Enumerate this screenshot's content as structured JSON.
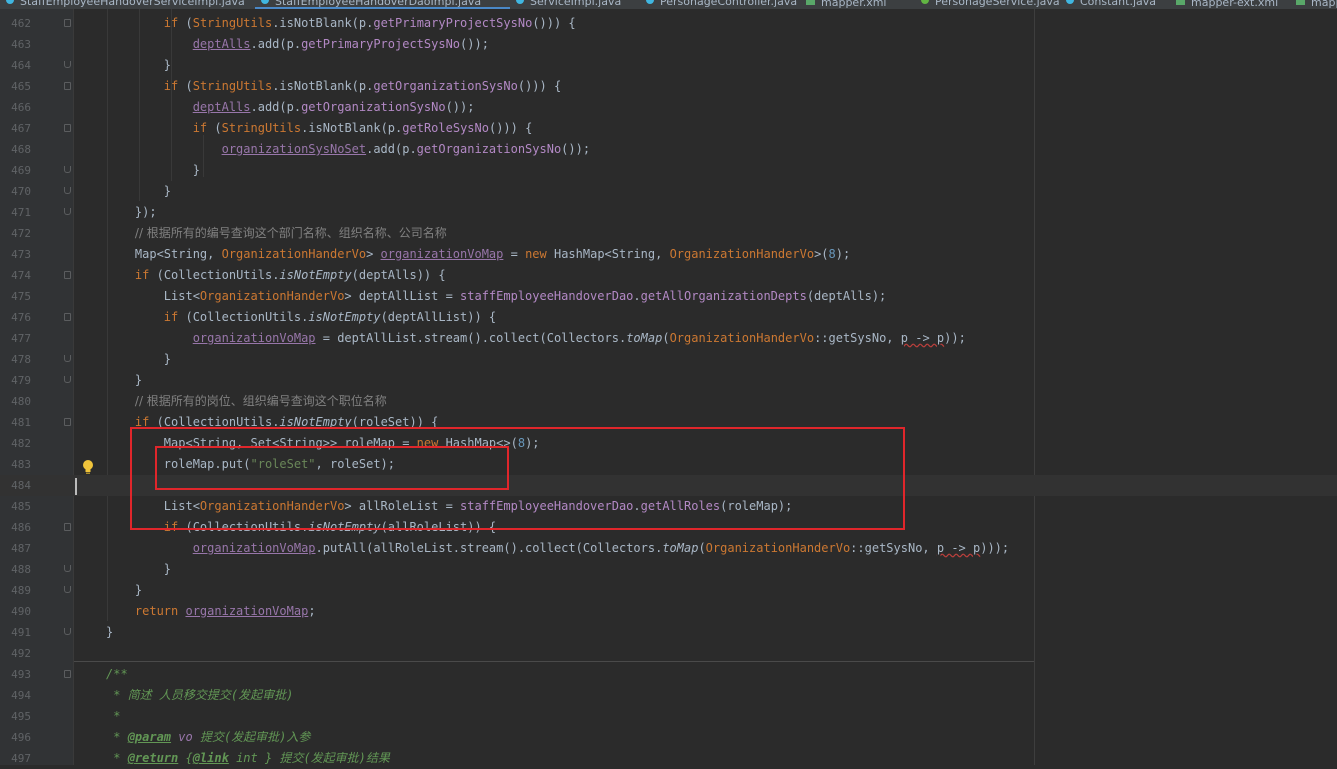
{
  "editor_tabs": [
    {
      "label": "StaffEmployeeHandoverServiceImpl.java",
      "kind": "java",
      "active": false
    },
    {
      "label": "StaffEmployeeHandoverDaoImpl.java",
      "kind": "java",
      "active": true
    },
    {
      "label": "ServiceImpl.java",
      "kind": "java",
      "active": false
    },
    {
      "label": "PersonageController.java",
      "kind": "java",
      "active": false
    },
    {
      "label": "mapper.xml",
      "kind": "xml",
      "active": false
    },
    {
      "label": "PersonageService.java",
      "kind": "service",
      "active": false
    },
    {
      "label": "Constant.java",
      "kind": "java",
      "active": false
    },
    {
      "label": "mapper-ext.xml",
      "kind": "xml",
      "active": false
    },
    {
      "label": "mapper.xml",
      "kind": "xml",
      "active": false
    }
  ],
  "lines": [
    {
      "num": "462",
      "tokens": [
        [
          "plain",
          "        "
        ],
        [
          "kw",
          "if "
        ],
        [
          "plain",
          "("
        ],
        [
          "ty",
          "StringUtils"
        ],
        [
          "plain",
          ".isNotBlank(p."
        ],
        [
          "mtd",
          "getPrimaryProjectSysNo"
        ],
        [
          "plain",
          "())) {"
        ]
      ]
    },
    {
      "num": "463",
      "tokens": [
        [
          "plain",
          "            "
        ],
        [
          "fld ul",
          "deptAlls"
        ],
        [
          "plain",
          ".add(p."
        ],
        [
          "mtd",
          "getPrimaryProjectSysNo"
        ],
        [
          "plain",
          "());"
        ]
      ]
    },
    {
      "num": "464",
      "tokens": [
        [
          "plain",
          "        }"
        ]
      ]
    },
    {
      "num": "465",
      "tokens": [
        [
          "plain",
          "        "
        ],
        [
          "kw",
          "if "
        ],
        [
          "plain",
          "("
        ],
        [
          "ty",
          "StringUtils"
        ],
        [
          "plain",
          ".isNotBlank(p."
        ],
        [
          "mtd",
          "getOrganizationSysNo"
        ],
        [
          "plain",
          "())) {"
        ]
      ]
    },
    {
      "num": "466",
      "tokens": [
        [
          "plain",
          "            "
        ],
        [
          "fld ul",
          "deptAlls"
        ],
        [
          "plain",
          ".add(p."
        ],
        [
          "mtd",
          "getOrganizationSysNo"
        ],
        [
          "plain",
          "());"
        ]
      ]
    },
    {
      "num": "467",
      "tokens": [
        [
          "plain",
          "            "
        ],
        [
          "kw",
          "if "
        ],
        [
          "plain",
          "("
        ],
        [
          "ty",
          "StringUtils"
        ],
        [
          "plain",
          ".isNotBlank(p."
        ],
        [
          "mtd",
          "getRoleSysNo"
        ],
        [
          "plain",
          "())) {"
        ]
      ]
    },
    {
      "num": "468",
      "tokens": [
        [
          "plain",
          "                "
        ],
        [
          "fld ul",
          "organizationSysNoSet"
        ],
        [
          "plain",
          ".add(p."
        ],
        [
          "mtd",
          "getOrganizationSysNo"
        ],
        [
          "plain",
          "());"
        ]
      ]
    },
    {
      "num": "469",
      "tokens": [
        [
          "plain",
          "            }"
        ]
      ]
    },
    {
      "num": "470",
      "tokens": [
        [
          "plain",
          "        }"
        ]
      ]
    },
    {
      "num": "471",
      "tokens": [
        [
          "plain",
          "    });"
        ]
      ]
    },
    {
      "num": "472",
      "tokens": [
        [
          "plain",
          "    "
        ],
        [
          "cm",
          "// 根据所有的编号查询这个部门名称、组织名称、公司名称"
        ]
      ]
    },
    {
      "num": "473",
      "tokens": [
        [
          "plain",
          "    Map<String, "
        ],
        [
          "ty",
          "OrganizationHanderVo"
        ],
        [
          "plain",
          "> "
        ],
        [
          "fld ul",
          "organizationVoMap"
        ],
        [
          "plain",
          " = "
        ],
        [
          "kw",
          "new "
        ],
        [
          "plain",
          "HashMap<String, "
        ],
        [
          "ty",
          "OrganizationHanderVo"
        ],
        [
          "plain",
          ">("
        ],
        [
          "num",
          "8"
        ],
        [
          "plain",
          ");"
        ]
      ]
    },
    {
      "num": "474",
      "tokens": [
        [
          "plain",
          "    "
        ],
        [
          "kw",
          "if "
        ],
        [
          "plain",
          "(CollectionUtils."
        ],
        [
          "it",
          "isNotEmpty"
        ],
        [
          "plain",
          "(deptAlls)) {"
        ]
      ]
    },
    {
      "num": "475",
      "tokens": [
        [
          "plain",
          "        List<"
        ],
        [
          "ty",
          "OrganizationHanderVo"
        ],
        [
          "plain",
          "> deptAllList = "
        ],
        [
          "mtd",
          "staffEmployeeHandoverDao"
        ],
        [
          "plain",
          "."
        ],
        [
          "mtd",
          "getAllOrganizationDepts"
        ],
        [
          "plain",
          "(deptAlls);"
        ]
      ]
    },
    {
      "num": "476",
      "tokens": [
        [
          "plain",
          "        "
        ],
        [
          "kw",
          "if "
        ],
        [
          "plain",
          "(CollectionUtils."
        ],
        [
          "it",
          "isNotEmpty"
        ],
        [
          "plain",
          "(deptAllList)) {"
        ]
      ]
    },
    {
      "num": "477",
      "tokens": [
        [
          "plain",
          "            "
        ],
        [
          "fld ul",
          "organizationVoMap"
        ],
        [
          "plain",
          " = deptAllList.stream().collect(Collectors."
        ],
        [
          "it",
          "toMap"
        ],
        [
          "plain",
          "("
        ],
        [
          "ty",
          "OrganizationHanderVo"
        ],
        [
          "plain",
          "::getSysNo, "
        ],
        [
          "wavy",
          "p -> p"
        ],
        [
          "plain",
          "));"
        ]
      ]
    },
    {
      "num": "478",
      "tokens": [
        [
          "plain",
          "        }"
        ]
      ]
    },
    {
      "num": "479",
      "tokens": [
        [
          "plain",
          "    }"
        ]
      ]
    },
    {
      "num": "480",
      "tokens": [
        [
          "plain",
          "    "
        ],
        [
          "cm",
          "// 根据所有的岗位、组织编号查询这个职位名称"
        ]
      ]
    },
    {
      "num": "481",
      "tokens": [
        [
          "plain",
          "    "
        ],
        [
          "kw",
          "if "
        ],
        [
          "plain",
          "(CollectionUtils."
        ],
        [
          "it",
          "isNotEmpty"
        ],
        [
          "plain",
          "(roleSet)) {"
        ]
      ]
    },
    {
      "num": "482",
      "tokens": [
        [
          "plain",
          "        Map<String, Set<String>> roleMap = "
        ],
        [
          "kw",
          "new "
        ],
        [
          "plain",
          "HashMap<>("
        ],
        [
          "num",
          "8"
        ],
        [
          "plain",
          ");"
        ]
      ]
    },
    {
      "num": "483",
      "tokens": [
        [
          "plain",
          "        roleMap.put("
        ],
        [
          "str",
          "\"roleSet\""
        ],
        [
          "plain",
          ", roleSet);"
        ]
      ]
    },
    {
      "num": "484",
      "tokens": []
    },
    {
      "num": "485",
      "tokens": [
        [
          "plain",
          "        List<"
        ],
        [
          "ty",
          "OrganizationHanderVo"
        ],
        [
          "plain",
          "> allRoleList = "
        ],
        [
          "mtd",
          "staffEmployeeHandoverDao"
        ],
        [
          "plain",
          "."
        ],
        [
          "mtd",
          "getAllRoles"
        ],
        [
          "plain",
          "(roleMap);"
        ]
      ]
    },
    {
      "num": "486",
      "tokens": [
        [
          "plain",
          "        "
        ],
        [
          "kw",
          "if "
        ],
        [
          "plain",
          "(CollectionUtils."
        ],
        [
          "it",
          "isNotEmpty"
        ],
        [
          "plain",
          "(allRoleList)) {"
        ]
      ]
    },
    {
      "num": "487",
      "tokens": [
        [
          "plain",
          "            "
        ],
        [
          "fld ul",
          "organizationVoMap"
        ],
        [
          "plain",
          ".putAll(allRoleList.stream().collect(Collectors."
        ],
        [
          "it",
          "toMap"
        ],
        [
          "plain",
          "("
        ],
        [
          "ty",
          "OrganizationHanderVo"
        ],
        [
          "plain",
          "::getSysNo, "
        ],
        [
          "wavy",
          "p -> p"
        ],
        [
          "plain",
          ")));"
        ]
      ]
    },
    {
      "num": "488",
      "tokens": [
        [
          "plain",
          "        }"
        ]
      ]
    },
    {
      "num": "489",
      "tokens": [
        [
          "plain",
          "    }"
        ]
      ]
    },
    {
      "num": "490",
      "tokens": [
        [
          "plain",
          "    "
        ],
        [
          "kw",
          "return "
        ],
        [
          "fld ul",
          "organizationVoMap"
        ],
        [
          "plain",
          ";"
        ]
      ]
    },
    {
      "num": "491",
      "tokens": [
        [
          "plain",
          "}"
        ]
      ]
    },
    {
      "num": "492",
      "tokens": []
    },
    {
      "num": "493",
      "tokens": [
        [
          "doc",
          "/**"
        ]
      ]
    },
    {
      "num": "494",
      "tokens": [
        [
          "doc",
          " * 简述 人员移交提交(发起审批)"
        ]
      ]
    },
    {
      "num": "495",
      "tokens": [
        [
          "doc",
          " *"
        ]
      ]
    },
    {
      "num": "496",
      "tokens": [
        [
          "doc",
          " * "
        ],
        [
          "doctag",
          "@param"
        ],
        [
          "doc",
          " "
        ],
        [
          "fld it",
          "vo"
        ],
        [
          "doc",
          " 提交(发起审批)入参"
        ]
      ]
    },
    {
      "num": "497",
      "tokens": [
        [
          "doc",
          " * "
        ],
        [
          "doctag",
          "@return"
        ],
        [
          "doc",
          " {"
        ],
        [
          "doctag",
          "@link"
        ],
        [
          "doc",
          " "
        ],
        [
          "doc",
          "int"
        ],
        [
          "doc",
          " } 提交(发起审批)结果"
        ]
      ]
    }
  ],
  "current_line": "484",
  "colors": {
    "background": "#2b2b2b",
    "gutter": "#313335",
    "annotation_box": "#e0262b"
  }
}
